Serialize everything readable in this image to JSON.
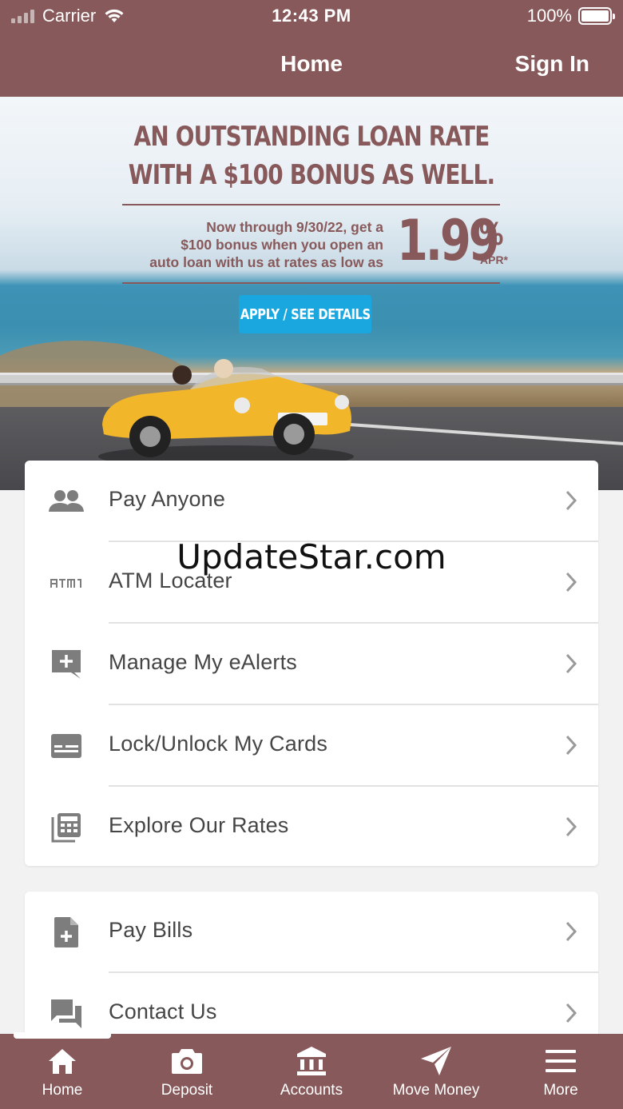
{
  "status_bar": {
    "carrier": "Carrier",
    "time": "12:43 PM",
    "battery": "100%"
  },
  "nav": {
    "title": "Home",
    "sign_in": "Sign In"
  },
  "banner": {
    "headline_line1": "AN OUTSTANDING LOAN RATE",
    "headline_line2": "WITH A $100 BONUS AS WELL.",
    "body_line1": "Now through 9/30/22, get a",
    "body_line2": "$100 bonus when you open an",
    "body_line3": "auto loan with us at rates as low as",
    "rate": "1.99",
    "rate_symbol": "%",
    "rate_suffix": "APR*",
    "cta": "APPLY / SEE DETAILS",
    "colors": {
      "brand": "#87595a",
      "cta": "#1aa7e0",
      "car": "#f2b62b"
    }
  },
  "watermark": "UpdateStar.com",
  "menu_group_1": [
    {
      "label": "Pay Anyone",
      "icon": "people-icon"
    },
    {
      "label": "ATM Locater",
      "icon": "atm-icon"
    },
    {
      "label": "Manage My eAlerts",
      "icon": "add-alert-icon"
    },
    {
      "label": "Lock/Unlock My Cards",
      "icon": "card-icon"
    },
    {
      "label": "Explore Our Rates",
      "icon": "calculator-icon"
    }
  ],
  "menu_group_2": [
    {
      "label": "Pay Bills",
      "icon": "bill-icon"
    },
    {
      "label": "Contact Us",
      "icon": "chat-icon"
    }
  ],
  "tabbar": [
    {
      "label": "Home",
      "icon": "home-icon"
    },
    {
      "label": "Deposit",
      "icon": "camera-icon"
    },
    {
      "label": "Accounts",
      "icon": "bank-icon"
    },
    {
      "label": "Move Money",
      "icon": "send-icon"
    },
    {
      "label": "More",
      "icon": "menu-icon"
    }
  ],
  "theme": {
    "header_bg": "#87595a",
    "text": "#454545",
    "icon": "#7d7d7d"
  }
}
